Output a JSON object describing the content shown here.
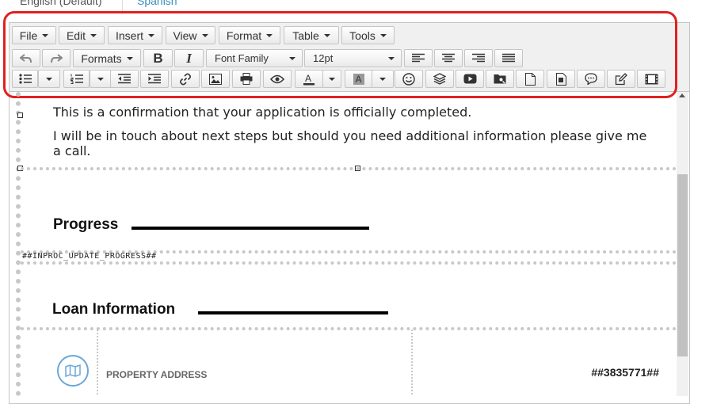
{
  "tabs": [
    {
      "label": "English (Default)"
    },
    {
      "label": "Spanish"
    }
  ],
  "menubar": [
    {
      "label": "File"
    },
    {
      "label": "Edit"
    },
    {
      "label": "Insert"
    },
    {
      "label": "View"
    },
    {
      "label": "Format"
    },
    {
      "label": "Table"
    },
    {
      "label": "Tools"
    }
  ],
  "toolbar": {
    "formats_label": "Formats",
    "font_family": "Font Family",
    "font_size": "12pt",
    "bold": "B",
    "italic": "I"
  },
  "content": {
    "line1": "This is a confirmation that your application is officially completed.",
    "line2a": "I will be in touch about next steps but should you need additional information please give me",
    "line2b": "a call.",
    "progress_heading": "Progress",
    "progress_code": "##INPROC_UPDATE_PROGRESS##",
    "loan_heading": "Loan Information",
    "property_label": "PROPERTY ADDRESS",
    "property_code": "##3835771##"
  },
  "colors": {
    "highlight": "#e02020",
    "link": "#3c8dbc"
  }
}
